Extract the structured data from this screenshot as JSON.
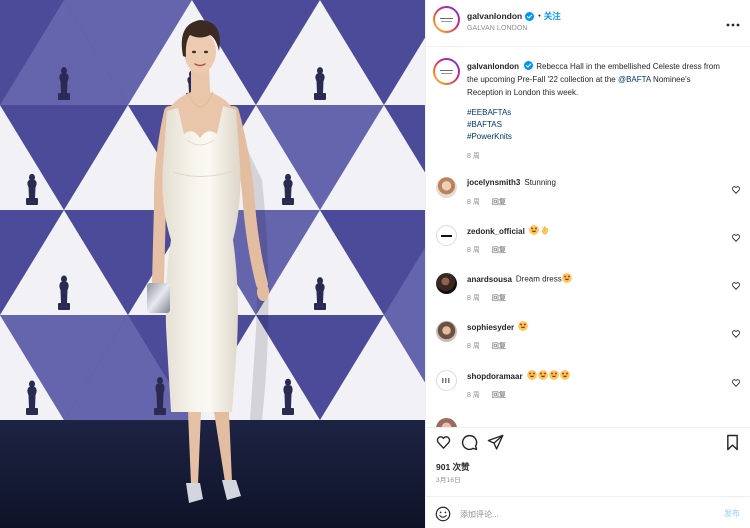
{
  "post": {
    "author": {
      "username": "galvanlondon",
      "verified": true,
      "separator": "•",
      "follow_label": "关注",
      "display_name": "GALVAN LONDON"
    },
    "caption": {
      "username": "galvanlondon",
      "text_before": "Rebecca Hall in the embellished Celeste dress from the upcoming Pre-Fall '22 collection at the ",
      "mention": "@BAFTA",
      "text_after": " Nominee's Reception in London this week.",
      "hashtags": [
        "#EEBAFTAs",
        "#BAFTAS",
        "#PowerKnits"
      ],
      "time": "8 周"
    },
    "comments": [
      {
        "username": "jocelynsmith3",
        "text": "Stunning",
        "time": "8 周",
        "reply_label": "回复"
      },
      {
        "username": "zedonk_official",
        "emoji": [
          "smiling-face-with-heart-eyes",
          "clapping-hands"
        ],
        "time": "8 周",
        "reply_label": "回复"
      },
      {
        "username": "anardsousa",
        "text": "Dream dress",
        "emoji": [
          "smiling-face-with-heart-eyes"
        ],
        "time": "8 周",
        "reply_label": "回复"
      },
      {
        "username": "sophiesyder",
        "emoji": [
          "smiling-face-with-heart-eyes"
        ],
        "time": "8 周",
        "reply_label": "回复"
      },
      {
        "username": "shopdoramaar",
        "emoji": [
          "smiling-face-with-heart-eyes",
          "smiling-face-with-heart-eyes",
          "smiling-face-with-heart-eyes",
          "smiling-face-with-heart-eyes"
        ],
        "time": "8 周",
        "reply_label": "回复"
      }
    ],
    "likes": "901 次赞",
    "date": "3月16日",
    "add_comment": {
      "placeholder": "添加评论...",
      "post_label": "发布"
    }
  },
  "icons": {
    "verified": "verified-badge-icon",
    "more": "more-horizontal-icon",
    "like": "heart-icon",
    "comment": "comment-bubble-icon",
    "share": "paper-plane-icon",
    "save": "bookmark-icon",
    "emoji_picker": "smiley-icon"
  },
  "colors": {
    "text": "#262626",
    "muted": "#8e8e8e",
    "link": "#00376b",
    "follow": "#0095f6",
    "verified": "#0095f6",
    "post_disabled": "#b3dbff",
    "backdrop_purple": "#4b4b99",
    "backdrop_lavender": "#6565ad",
    "backdrop_white": "#f1f1f6",
    "statuette": "#2a2a52",
    "floor": "#151a32",
    "dress": "#f3efe6"
  }
}
